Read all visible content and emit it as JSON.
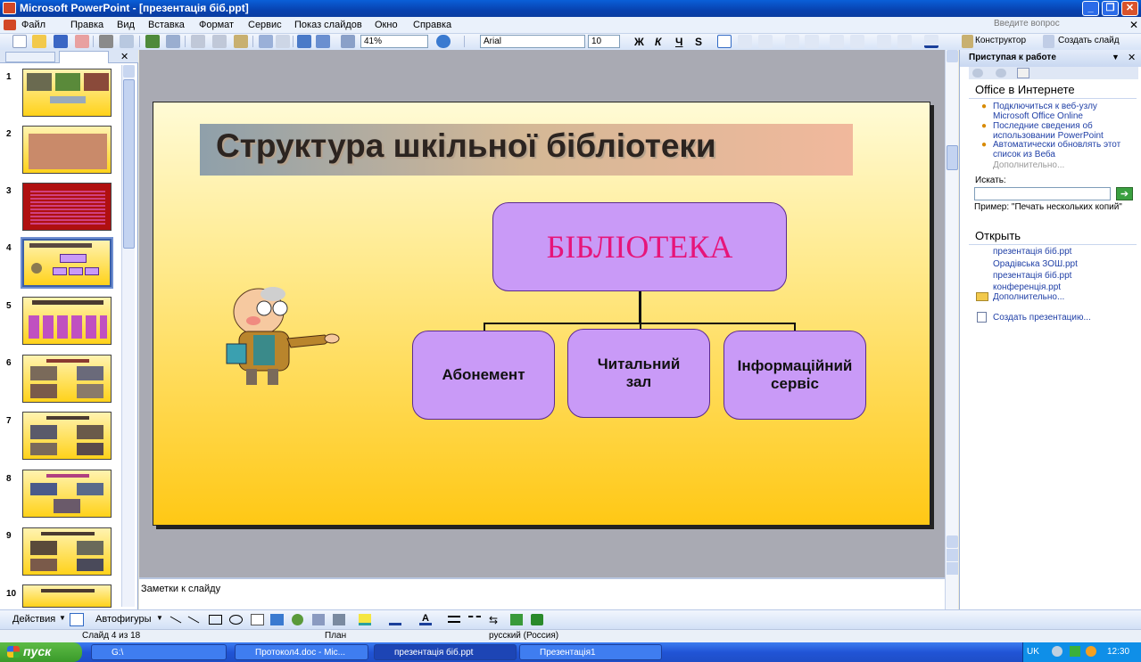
{
  "window": {
    "title": "Microsoft PowerPoint - [презентація біб.ppt]"
  },
  "menu": {
    "items": [
      "Файл",
      "Правка",
      "Вид",
      "Вставка",
      "Формат",
      "Сервис",
      "Показ слайдов",
      "Окно",
      "Справка"
    ],
    "ask_placeholder": "Введите вопрос"
  },
  "toolbar": {
    "zoom": "41%",
    "font": "Arial",
    "size": "10",
    "bold": "Ж",
    "italic": "К",
    "underline": "Ч",
    "shadow": "S",
    "designer": "Конструктор",
    "new_slide": "Создать слайд"
  },
  "slides_pane": {
    "numbers": [
      "1",
      "2",
      "3",
      "4",
      "5",
      "6",
      "7",
      "8",
      "9",
      "10"
    ],
    "selected": "4"
  },
  "slide": {
    "title": "Структура шкільної бібліотеки",
    "top_box": "БІБЛІОТЕКА",
    "box1": "Абонемент",
    "box2": "Читальний зал",
    "box3": "Інформаційний сервіс"
  },
  "notes": {
    "placeholder": "Заметки к слайду"
  },
  "task_pane": {
    "title": "Приступая к работе",
    "section1": "Office в Интернете",
    "links": [
      "Подключиться к веб-узлу Microsoft Office Online",
      "Последние сведения об использовании PowerPoint",
      "Автоматически обновлять этот список из Веба"
    ],
    "more1": "Дополнительно...",
    "search_label": "Искать:",
    "example": "Пример: \"Печать нескольких копий\"",
    "section2": "Открыть",
    "files": [
      "презентація біб.ppt",
      "Орадівська ЗОШ.ppt",
      "презентація біб.ppt",
      "конференція.ppt"
    ],
    "more2": "Дополнительно...",
    "create": "Создать презентацию..."
  },
  "drawbar": {
    "actions": "Действия",
    "autoshapes": "Автофигуры"
  },
  "status": {
    "slide": "Слайд 4 из 18",
    "design": "План",
    "language": "русский (Россия)"
  },
  "taskbar": {
    "start": "пуск",
    "tasks": [
      "G:\\",
      "Протокол4.doc - Mic...",
      "презентація біб.ppt",
      "Презентація1"
    ],
    "lang": "UK",
    "time": "12:30"
  },
  "colors": {
    "accent": "#e6157a",
    "box_fill": "#c99af7",
    "slide_gradient_bottom": "#ffc815"
  }
}
